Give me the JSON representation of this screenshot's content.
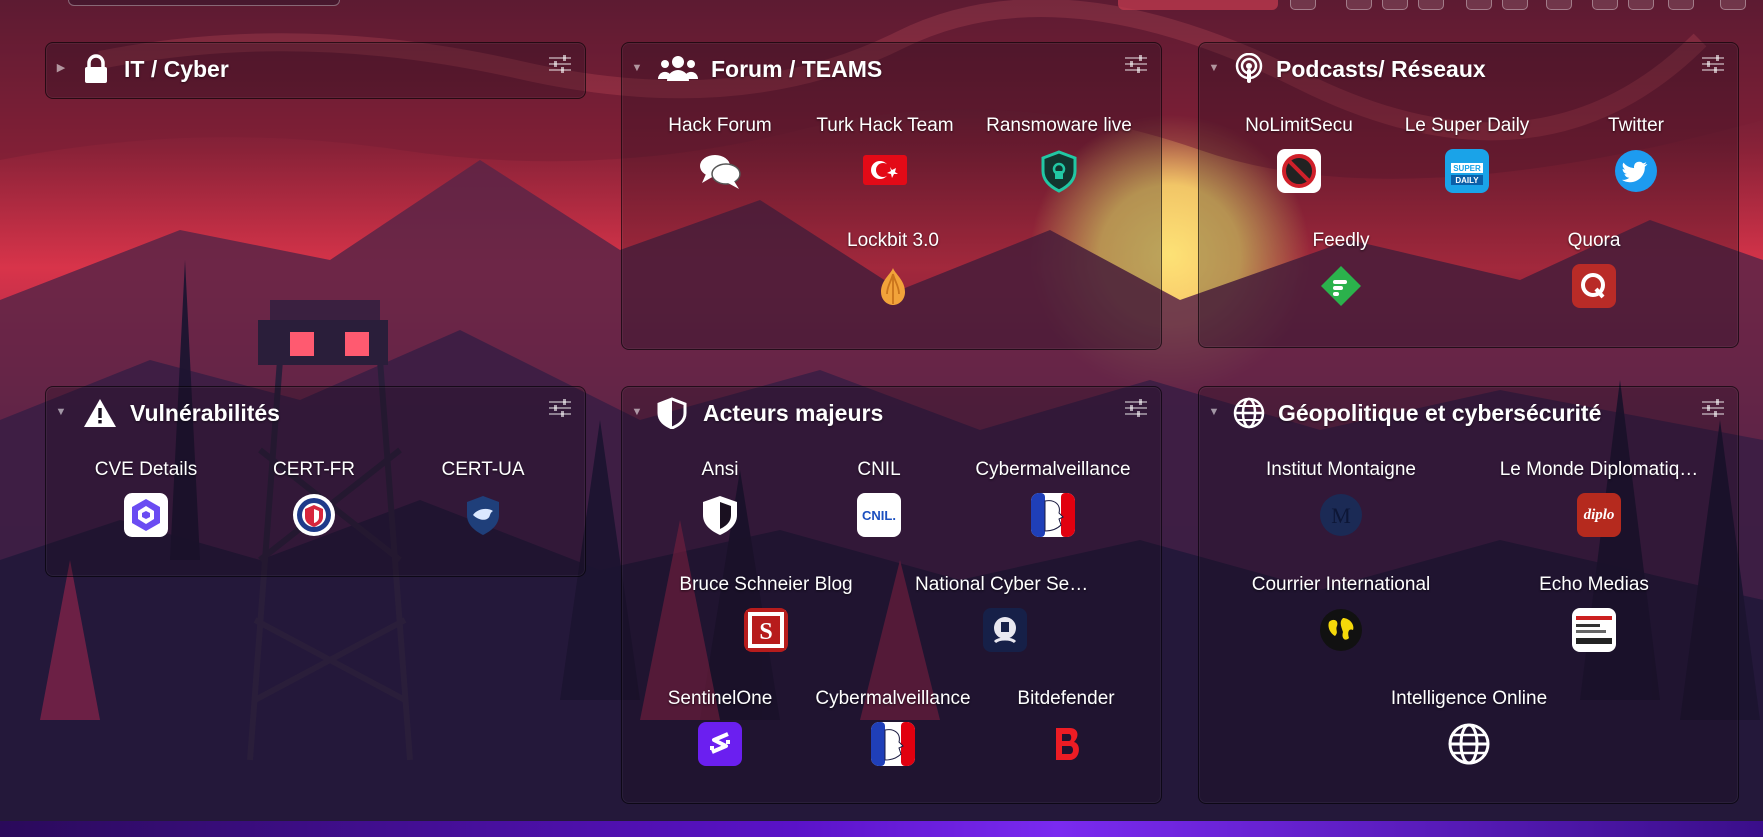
{
  "colors": {
    "accent": "#7a2af0",
    "panel_border": "#000000"
  },
  "panels": [
    {
      "title": "IT / Cyber",
      "icon": "lock-icon",
      "collapsed": true,
      "tiles": []
    },
    {
      "title": "Forum / TEAMS",
      "icon": "users-icon",
      "collapsed": false,
      "tiles": [
        {
          "label": "Hack Forum",
          "icon": "chat-bubbles-icon"
        },
        {
          "label": "Turk Hack Team",
          "icon": "turkey-flag-icon"
        },
        {
          "label": "Ransmoware live",
          "icon": "shield-lock-icon"
        },
        {
          "label": "Lockbit 3.0",
          "icon": "onion-icon"
        }
      ]
    },
    {
      "title": "Podcasts/ Réseaux",
      "icon": "podcast-icon",
      "collapsed": false,
      "tiles": [
        {
          "label": "NoLimitSecu",
          "icon": "nolimitsecu-icon"
        },
        {
          "label": "Le Super Daily",
          "icon": "super-daily-icon"
        },
        {
          "label": "Twitter",
          "icon": "twitter-icon"
        },
        {
          "label": "Feedly",
          "icon": "feedly-icon"
        },
        {
          "label": "Quora",
          "icon": "quora-icon"
        }
      ]
    },
    {
      "title": "Vulnérabilités",
      "icon": "warning-icon",
      "collapsed": false,
      "tiles": [
        {
          "label": "CVE Details",
          "icon": "cve-icon"
        },
        {
          "label": "CERT-FR",
          "icon": "cert-fr-icon"
        },
        {
          "label": "CERT-UA",
          "icon": "cert-ua-icon"
        }
      ]
    },
    {
      "title": "Acteurs majeurs",
      "icon": "half-shield-icon",
      "collapsed": false,
      "tiles": [
        {
          "label": "Ansi",
          "icon": "anssi-shield-icon"
        },
        {
          "label": "CNIL",
          "icon": "cnil-icon"
        },
        {
          "label": "Cybermalveillance",
          "icon": "marianne-icon"
        },
        {
          "label": "Bruce Schneier Blog",
          "icon": "schneier-icon"
        },
        {
          "label": "National Cyber Secur…",
          "icon": "ncsc-crest-icon"
        },
        {
          "label": "SentinelOne",
          "icon": "sentinelone-icon"
        },
        {
          "label": "Cybermalveillance",
          "icon": "marianne-icon"
        },
        {
          "label": "Bitdefender",
          "icon": "bitdefender-icon"
        }
      ]
    },
    {
      "title": "Géopolitique et cybersécurité",
      "icon": "globe-icon",
      "collapsed": false,
      "tiles": [
        {
          "label": "Institut Montaigne",
          "icon": "montaigne-icon"
        },
        {
          "label": "Le Monde Diplomatiq…",
          "icon": "diplo-icon"
        },
        {
          "label": "Courrier International",
          "icon": "courrier-globe-icon"
        },
        {
          "label": "Echo Medias",
          "icon": "echo-medias-icon"
        },
        {
          "label": "Intelligence Online",
          "icon": "globe-icon"
        }
      ]
    }
  ],
  "logos": {
    "cnil": "CNIL.",
    "diplo": "diplo",
    "super_daily": "SUPER DAILY"
  }
}
